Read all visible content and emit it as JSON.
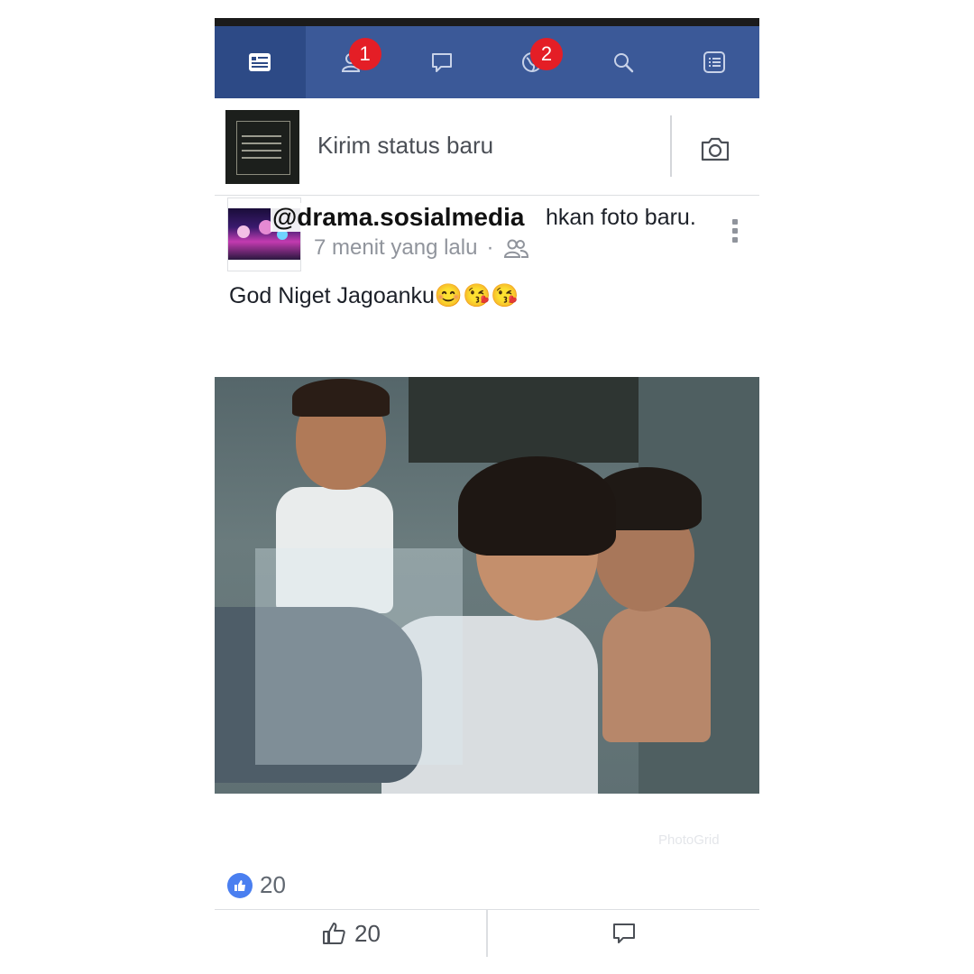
{
  "nav": {
    "tabs": [
      {
        "name": "news-feed",
        "icon": "news-feed-icon",
        "badge": ""
      },
      {
        "name": "friend-requests",
        "icon": "friends-icon",
        "badge": "1"
      },
      {
        "name": "messages",
        "icon": "chat-bubble-icon",
        "badge": ""
      },
      {
        "name": "notifications",
        "icon": "globe-icon",
        "badge": "2"
      },
      {
        "name": "search",
        "icon": "search-icon",
        "badge": ""
      },
      {
        "name": "menu",
        "icon": "menu-list-icon",
        "badge": ""
      }
    ],
    "color": "#3b5998"
  },
  "composer": {
    "placeholder": "Kirim status baru",
    "camera_icon": "camera-icon"
  },
  "post": {
    "author_action": "hkan foto baru.",
    "watermark": "@drama.sosialmedia",
    "timestamp": "7 menit yang lalu",
    "separator": "·",
    "audience_icon": "friends-audience-icon",
    "text": "God Niget Jagoanku😊😘😘",
    "photo_credit": "PhotoGrid",
    "like_count": "20",
    "like_button_count": "20"
  }
}
